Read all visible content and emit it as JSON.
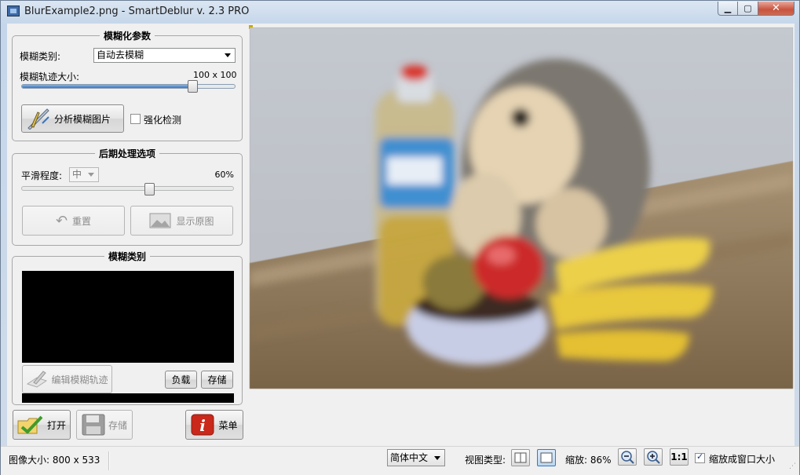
{
  "window": {
    "title": "BlurExample2.png - SmartDeblur v. 2.3 PRO"
  },
  "blur_params": {
    "title": "模糊化参数",
    "blur_type_label": "模糊类别:",
    "blur_type_value": "自动去模糊",
    "trajectory_label": "模糊轨迹大小:",
    "trajectory_value": "100 x 100",
    "trajectory_level": 0.8,
    "analyze_button": "分析模糊图片",
    "enhance_label": "强化检测"
  },
  "post": {
    "title": "后期处理选项",
    "smooth_label": "平滑程度:",
    "smooth_value": "中",
    "smooth_percent": "60%",
    "smooth_level": 0.6,
    "reset_button": "重置",
    "show_original_button": "显示原图"
  },
  "blur_kind": {
    "title": "模糊类别",
    "edit_button": "编辑模糊轨迹",
    "load_button": "负载",
    "save_button": "存储"
  },
  "bottom_buttons": {
    "open": "打开",
    "save": "存储",
    "menu": "菜单"
  },
  "status": {
    "image_size": "图像大小: 800 x 533",
    "language": "简体中文",
    "view_type_label": "视图类型:",
    "zoom_label": "缩放: 86%",
    "one_to_one": "1:1",
    "fit_label": "缩放成窗口大小",
    "fit_checked": true
  },
  "colors": {
    "accent": "#3a77c0",
    "close": "#c7533e"
  }
}
